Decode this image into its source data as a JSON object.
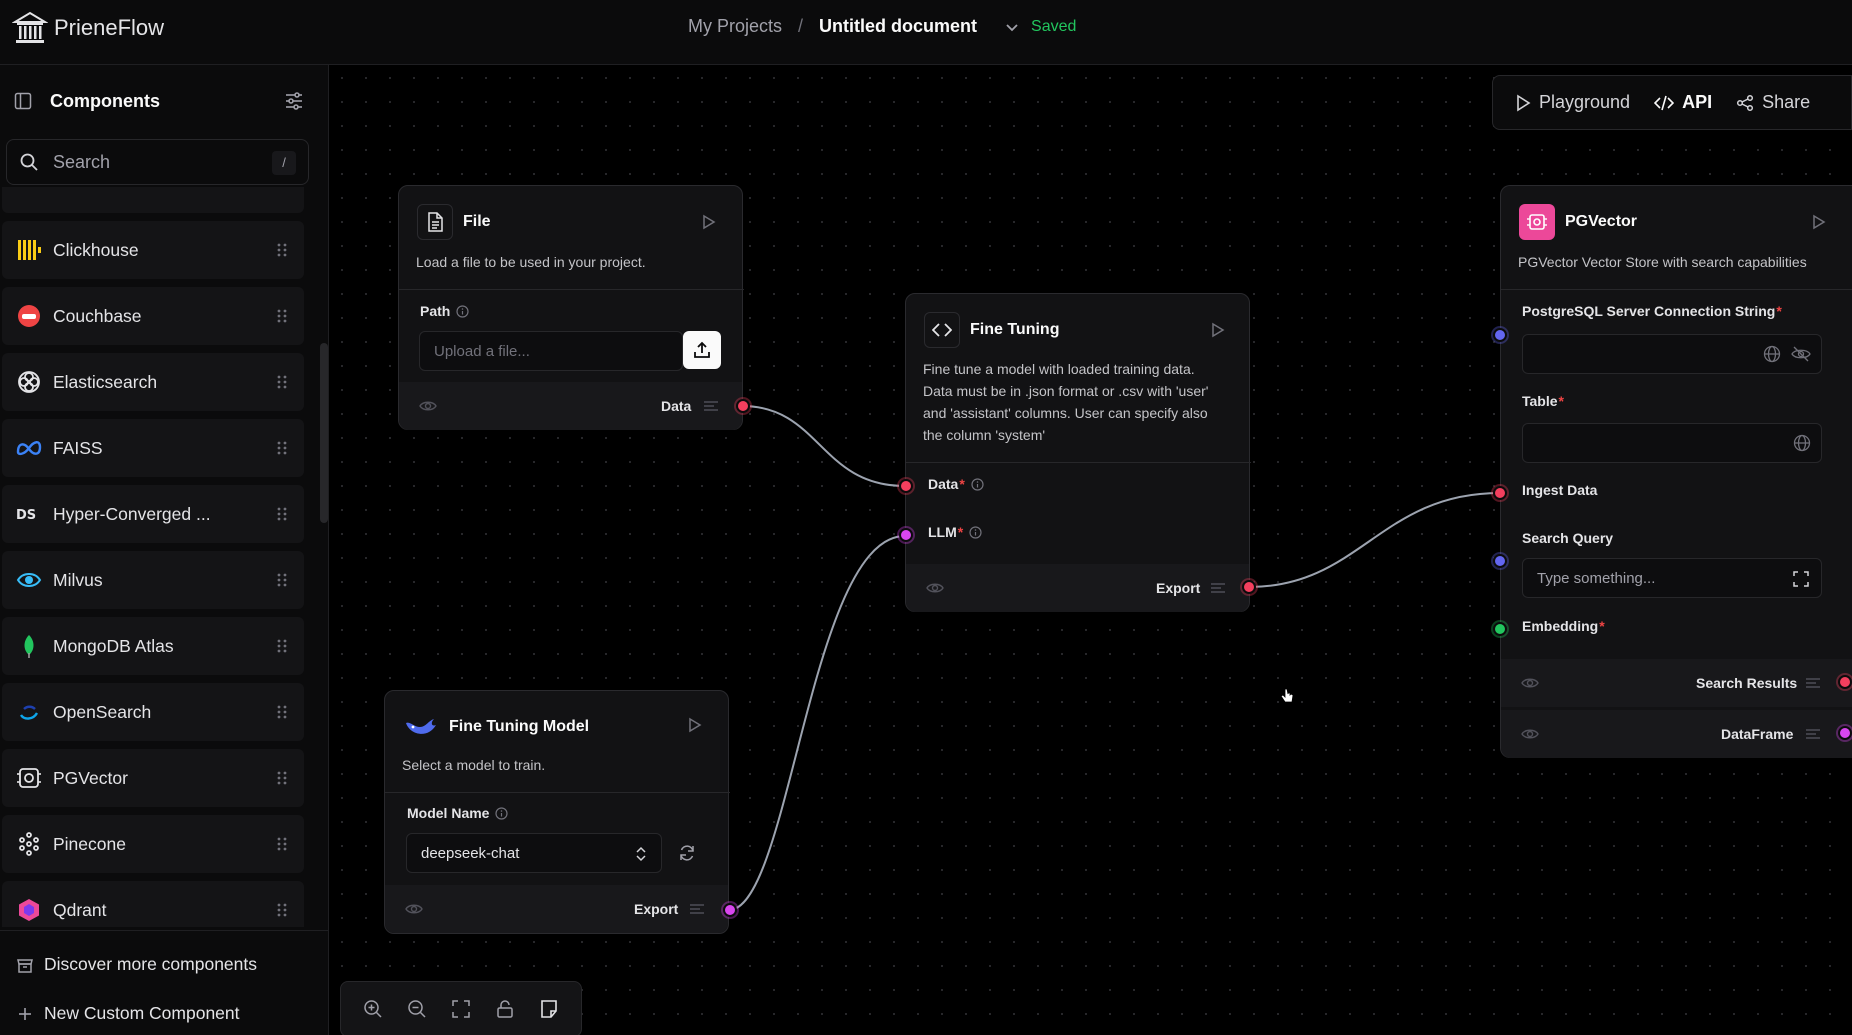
{
  "app": {
    "name": "PrieneFlow"
  },
  "breadcrumb": {
    "projects": "My Projects",
    "separator": "/",
    "document": "Untitled document",
    "status": "Saved"
  },
  "sidebar": {
    "title": "Components",
    "search_placeholder": "Search",
    "search_shortcut": "/",
    "items": [
      {
        "label": "Clickhouse",
        "icon": "clickhouse-icon",
        "color": "#facc15"
      },
      {
        "label": "Couchbase",
        "icon": "couchbase-icon",
        "color": "#ef4444"
      },
      {
        "label": "Elasticsearch",
        "icon": "elasticsearch-icon",
        "color": "#e4e4e7"
      },
      {
        "label": "FAISS",
        "icon": "faiss-icon",
        "color": "#3b82f6"
      },
      {
        "label": "Hyper-Converged ...",
        "icon": "hyper-converged-icon",
        "color": "#e4e4e7"
      },
      {
        "label": "Milvus",
        "icon": "milvus-icon",
        "color": "#38bdf8"
      },
      {
        "label": "MongoDB Atlas",
        "icon": "mongodb-icon",
        "color": "#22c55e"
      },
      {
        "label": "OpenSearch",
        "icon": "opensearch-icon",
        "color": "#0ea5e9"
      },
      {
        "label": "PGVector",
        "icon": "pgvector-icon",
        "color": "#e4e4e7"
      },
      {
        "label": "Pinecone",
        "icon": "pinecone-icon",
        "color": "#e4e4e7"
      },
      {
        "label": "Qdrant",
        "icon": "qdrant-icon",
        "color": "#ec4899"
      }
    ],
    "footer": {
      "discover": "Discover more components",
      "custom": "New Custom Component"
    }
  },
  "toolbar": {
    "playground": "Playground",
    "api": "API",
    "share": "Share"
  },
  "nodes": {
    "file": {
      "title": "File",
      "description": "Load a file to be used in your project.",
      "path_label": "Path",
      "upload_placeholder": "Upload a file...",
      "output": "Data"
    },
    "fine_tuning": {
      "title": "Fine Tuning",
      "description_lines": [
        "Fine tune a model with loaded training data.",
        "Data must be in .json format or .csv with 'user'",
        "and 'assistant' columns. User can specify also",
        "the column 'system'"
      ],
      "input_data": "Data",
      "input_llm": "LLM",
      "output": "Export"
    },
    "fine_tuning_model": {
      "title": "Fine Tuning Model",
      "description": "Select a model to train.",
      "model_label": "Model Name",
      "model_value": "deepseek-chat",
      "output": "Export"
    },
    "pgvector": {
      "title": "PGVector",
      "description": "PGVector Vector Store with search capabilities",
      "conn_label": "PostgreSQL Server Connection String",
      "table_label": "Table",
      "ingest_label": "Ingest Data",
      "search_label": "Search Query",
      "search_placeholder": "Type something...",
      "embedding_label": "Embedding",
      "output_results": "Search Results",
      "output_dataframe": "DataFrame"
    }
  },
  "colors": {
    "accent_green": "#22c55e",
    "port_red": "#f43f5e",
    "port_purple": "#d946ef",
    "port_blue": "#6366f1",
    "pg_brand": "#ec4899"
  }
}
